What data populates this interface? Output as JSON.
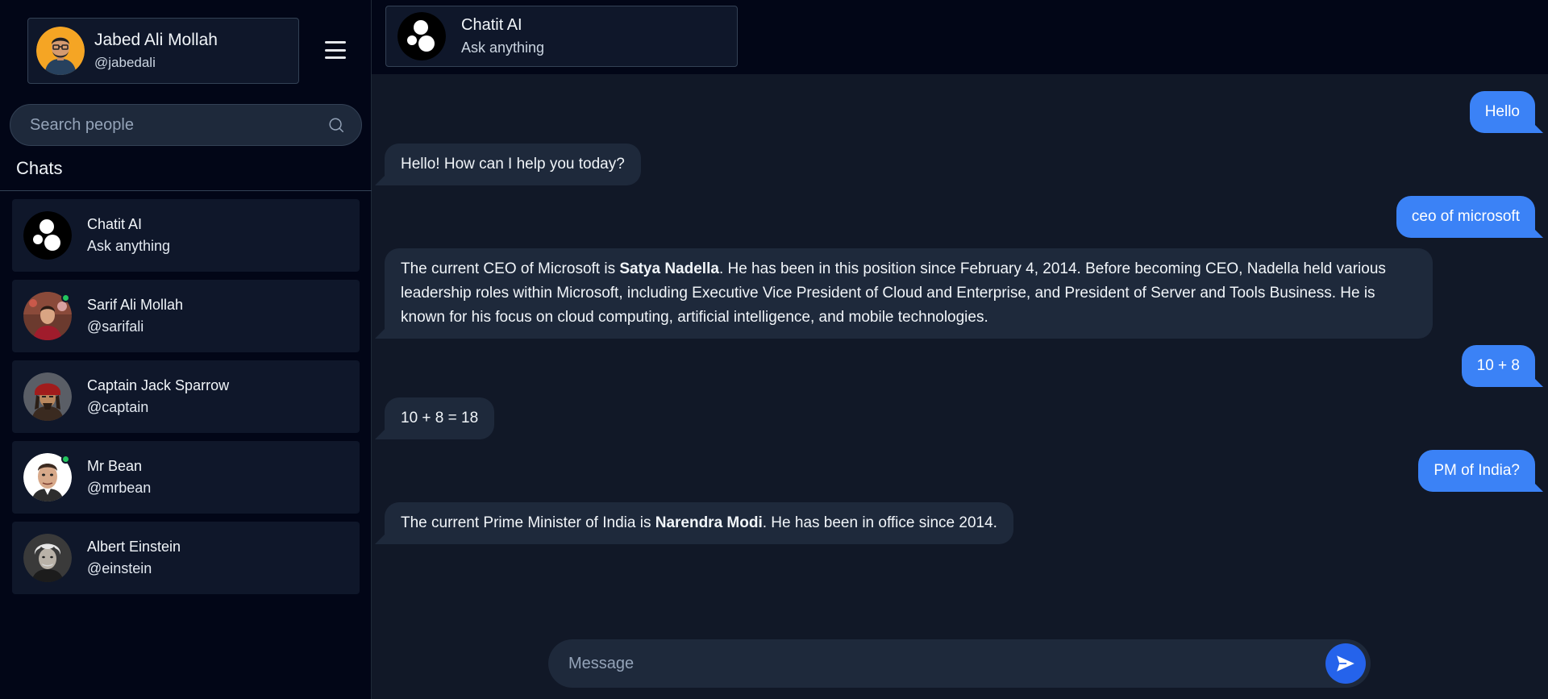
{
  "profile": {
    "name": "Jabed Ali Mollah",
    "handle": "@jabedali"
  },
  "icons": {
    "menu": "hamburger-menu-icon",
    "search": "search-icon",
    "send": "send-icon"
  },
  "colors": {
    "accent": "#3b82f6",
    "send_button": "#2563eb",
    "online": "#22c55e",
    "bot_bubble": "#1e293b",
    "sidebar_bg": "#020617",
    "chat_bg": "#111827"
  },
  "search": {
    "placeholder": "Search people"
  },
  "sidebar": {
    "heading": "Chats",
    "chats": [
      {
        "name": "Chatit AI",
        "sub": "Ask anything",
        "avatar": "ai-logo",
        "online": false
      },
      {
        "name": "Sarif Ali Mollah",
        "sub": "@sarifali",
        "avatar": "photo",
        "online": true
      },
      {
        "name": "Captain Jack Sparrow",
        "sub": "@captain",
        "avatar": "photo",
        "online": false
      },
      {
        "name": "Mr Bean",
        "sub": "@mrbean",
        "avatar": "photo",
        "online": true
      },
      {
        "name": "Albert Einstein",
        "sub": "@einstein",
        "avatar": "photo",
        "online": false
      }
    ]
  },
  "header": {
    "title": "Chatit AI",
    "subtitle": "Ask anything"
  },
  "messages": [
    {
      "from": "user",
      "text": "Hello"
    },
    {
      "from": "bot",
      "text": "Hello! How can I help you today?"
    },
    {
      "from": "user",
      "text": "ceo of microsoft"
    },
    {
      "from": "bot",
      "pre": "The current CEO of Microsoft is ",
      "bold": "Satya Nadella",
      "post": ". He has been in this position since February 4, 2014. Before becoming CEO, Nadella held various leadership roles within Microsoft, including Executive Vice President of Cloud and Enterprise, and President of Server and Tools Business. He is known for his focus on cloud computing, artificial intelligence, and mobile technologies."
    },
    {
      "from": "user",
      "text": "10 + 8"
    },
    {
      "from": "bot",
      "text": "10 + 8 = 18"
    },
    {
      "from": "user",
      "text": "PM of India?"
    },
    {
      "from": "bot",
      "pre": "The current Prime Minister of India is ",
      "bold": "Narendra Modi",
      "post": ". He has been in office since 2014."
    }
  ],
  "composer": {
    "placeholder": "Message"
  }
}
